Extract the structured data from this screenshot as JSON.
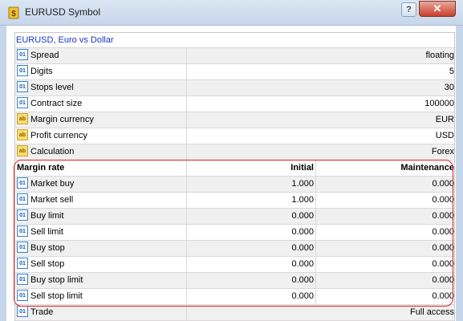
{
  "window": {
    "title": "EURUSD Symbol",
    "help_label": "?",
    "close_label": "✕"
  },
  "header": {
    "symbol_description": "EURUSD, Euro vs  Dollar"
  },
  "props": [
    {
      "icon": "01",
      "label": "Spread",
      "value": "floating"
    },
    {
      "icon": "01",
      "label": "Digits",
      "value": "5"
    },
    {
      "icon": "01",
      "label": "Stops level",
      "value": "30"
    },
    {
      "icon": "01",
      "label": "Contract size",
      "value": "100000"
    },
    {
      "icon": "ab",
      "label": "Margin currency",
      "value": "EUR"
    },
    {
      "icon": "ab",
      "label": "Profit currency",
      "value": "USD"
    },
    {
      "icon": "ab",
      "label": "Calculation",
      "value": "Forex"
    }
  ],
  "margin_table": {
    "title": "Margin rate",
    "col_initial": "Initial",
    "col_maintenance": "Maintenance",
    "rows": [
      {
        "icon": "01",
        "label": "Market buy",
        "initial": "1.000",
        "maintenance": "0.000"
      },
      {
        "icon": "01",
        "label": "Market sell",
        "initial": "1.000",
        "maintenance": "0.000"
      },
      {
        "icon": "01",
        "label": "Buy limit",
        "initial": "0.000",
        "maintenance": "0.000"
      },
      {
        "icon": "01",
        "label": "Sell limit",
        "initial": "0.000",
        "maintenance": "0.000"
      },
      {
        "icon": "01",
        "label": "Buy stop",
        "initial": "0.000",
        "maintenance": "0.000"
      },
      {
        "icon": "01",
        "label": "Sell stop",
        "initial": "0.000",
        "maintenance": "0.000"
      },
      {
        "icon": "01",
        "label": "Buy stop limit",
        "initial": "0.000",
        "maintenance": "0.000"
      },
      {
        "icon": "01",
        "label": "Sell stop limit",
        "initial": "0.000",
        "maintenance": "0.000"
      }
    ]
  },
  "trade": {
    "icon": "01",
    "label": "Trade",
    "value": "Full access"
  },
  "colors": {
    "annotation": "#e02020",
    "link": "#1a36c6",
    "frame": "#c6d6ea"
  }
}
